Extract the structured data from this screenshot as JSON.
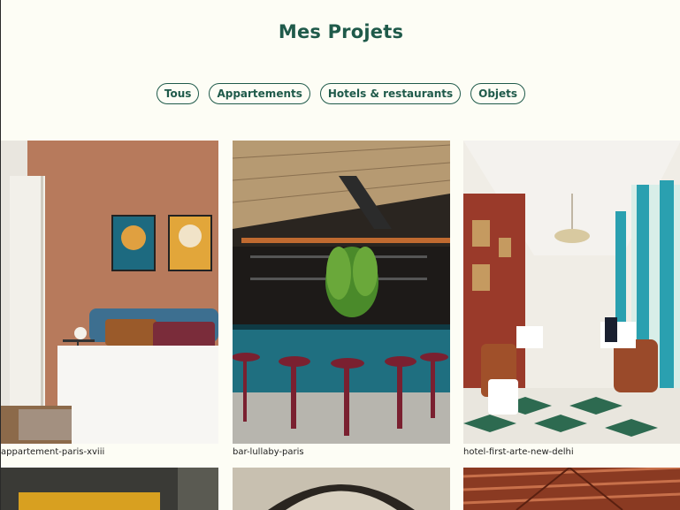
{
  "page": {
    "title": "Mes Projets"
  },
  "filters": [
    {
      "label": "Tous"
    },
    {
      "label": "Appartements"
    },
    {
      "label": "Hotels & restaurants"
    },
    {
      "label": "Objets"
    }
  ],
  "projects": [
    {
      "name": "appartement-paris-xviii"
    },
    {
      "name": "bar-lullaby-paris"
    },
    {
      "name": "hotel-first-arte-new-delhi"
    }
  ],
  "colors": {
    "accent": "#1f5a4a",
    "background": "#fdfdf5"
  }
}
